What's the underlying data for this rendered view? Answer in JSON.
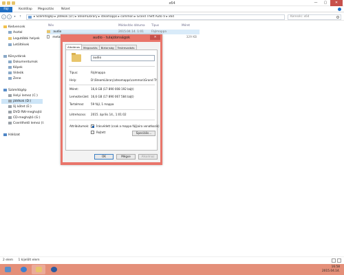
{
  "window": {
    "title": "x64"
  },
  "ribbon": {
    "file": "Fájl",
    "tabs": [
      "Kezdőlap",
      "Megosztás",
      "Nézet"
    ]
  },
  "address": {
    "path": "▸ Számítógép ▸ játékok (D:) ▸ SteamLibrary ▸ steamapps ▸ common ▸ Grand Theft Auto V ▸ x64",
    "search_placeholder": "Keresés: x64"
  },
  "nav": {
    "favorites": {
      "label": "Kedvencek",
      "items": [
        "Asztal",
        "Legutóbbi helyek",
        "Letöltések"
      ]
    },
    "libraries": {
      "label": "Könyvtárak",
      "items": [
        "Dokumentumok",
        "Képek",
        "Videók",
        "Zene"
      ]
    },
    "computer": {
      "label": "Számítógép",
      "items": [
        "Helyi lemez (C:)",
        "játékok (D:)",
        "Új kötet (E:)",
        "DVD RW-meghajtó",
        "CD-meghajtó (G:)",
        "Cserélhető lemez (I:)"
      ]
    },
    "network": {
      "label": "Hálózat"
    }
  },
  "files": {
    "headers": [
      "Név",
      "Módosítás dátuma",
      "Típus",
      "Méret"
    ],
    "rows": [
      {
        "name": "audio",
        "date": "2015.04.14. 1:01",
        "type": "Fájlmappa",
        "size": ""
      },
      {
        "name": "metad",
        "date": "",
        "type": "",
        "size": "329 KB"
      }
    ]
  },
  "status": {
    "count": "2 elem",
    "selected": "1 kijelölt elem"
  },
  "clock": {
    "time": "16:58",
    "date": "2015.04.14."
  },
  "dialog": {
    "title": "audio - tulajdonságok",
    "close": "✕",
    "tabs": [
      "Általános",
      "Megosztás",
      "Biztonság",
      "Testreszabás"
    ],
    "name": "audio",
    "fields": [
      {
        "label": "Típus:",
        "value": "Fájlmappa"
      },
      {
        "label": "Hely:",
        "value": "D:\\SteamLibrary\\steamapps\\common\\Grand The"
      },
      {
        "label": "Méret:",
        "value": "16,6 GB (17 890 008 192 bájt)"
      },
      {
        "label": "Lemezterület:",
        "value": "16,6 GB (17 890 067 584 bájt)"
      },
      {
        "label": "Tartalmaz:",
        "value": "59 fájl, 1 mappa"
      },
      {
        "label": "Létrehozva:",
        "value": "2015. április 14., 1:01:02"
      }
    ],
    "attributes_label": "Attribútumok:",
    "readonly_label": "Írásvédett (csak a mappa fájljaira vonatkozik)",
    "hidden_label": "Rejtett",
    "advanced_button": "Speciális...",
    "ok": "OK",
    "cancel": "Mégse",
    "apply": "Alkalmaz"
  },
  "icons": {
    "back": "arrow-left-icon",
    "forward": "arrow-right-icon",
    "up": "arrow-up-icon",
    "refresh": "refresh-icon",
    "search": "search-icon"
  },
  "colors": {
    "accent": "#1f6fc5",
    "dialog_frame": "#e9756a",
    "taskbar": "#e48f79",
    "close": "#c7504b"
  }
}
